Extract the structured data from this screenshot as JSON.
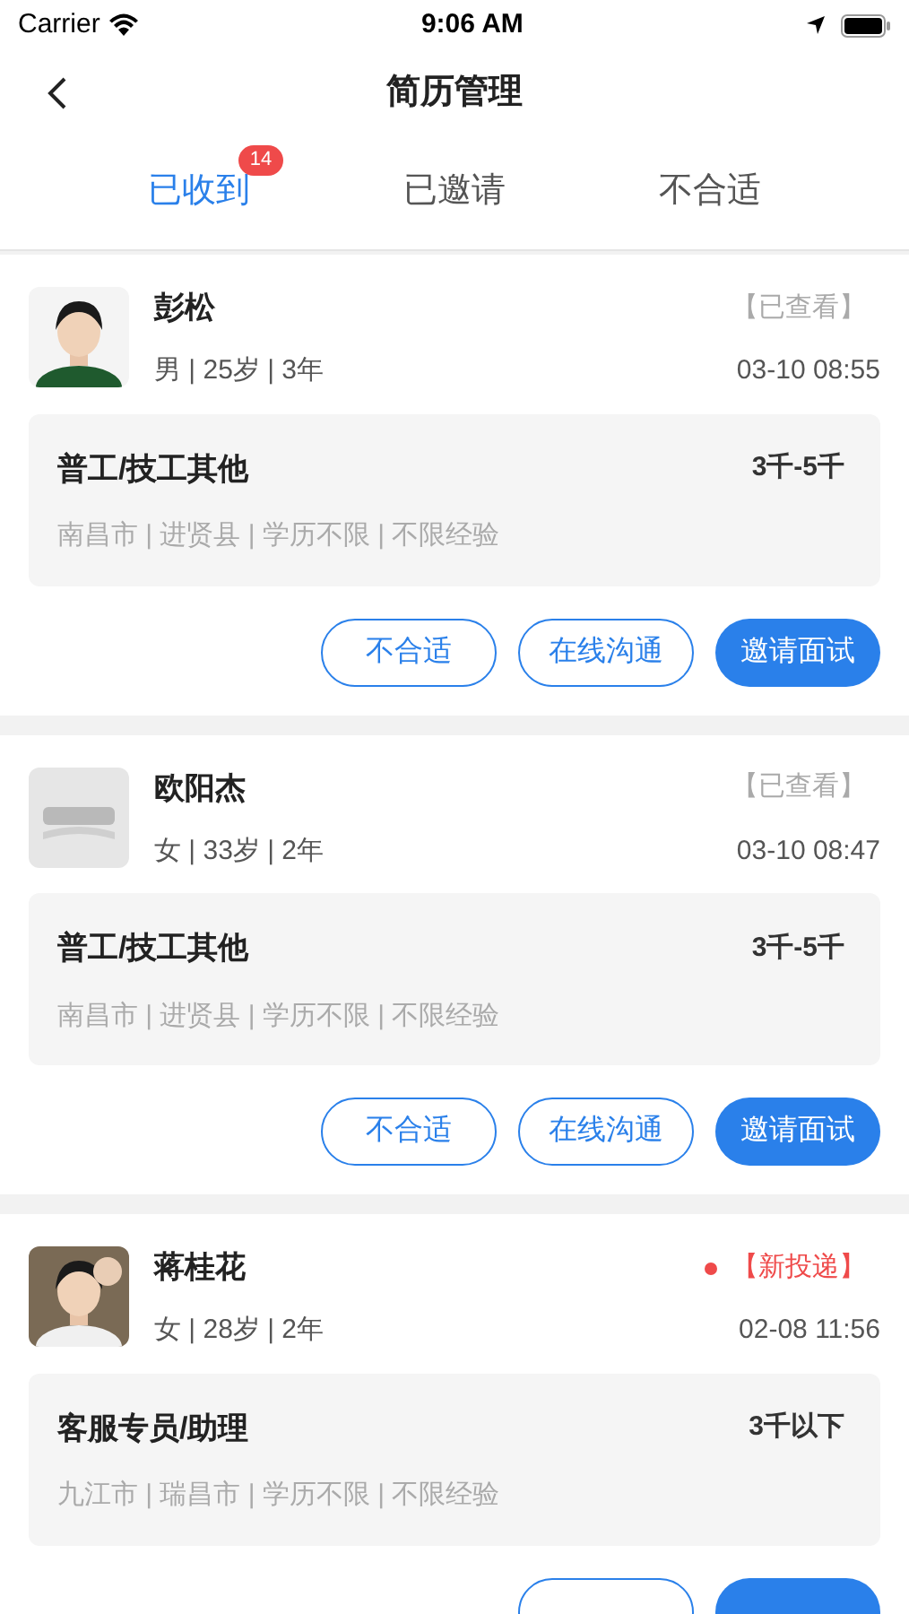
{
  "status_bar": {
    "carrier": "Carrier",
    "time": "9:06 AM"
  },
  "nav": {
    "title": "简历管理"
  },
  "tabs": [
    {
      "label": "已收到",
      "selected": true,
      "badge": "14"
    },
    {
      "label": "已邀请",
      "selected": false
    },
    {
      "label": "不合适",
      "selected": false
    }
  ],
  "resumes": [
    {
      "name": "彭松",
      "status": {
        "kind": "viewed",
        "label": "【已查看】"
      },
      "meta": "男 | 25岁 | 3年",
      "time": "03-10 08:55",
      "job": "普工/技工其他",
      "salary": "3千-5千",
      "details": "南昌市 | 进贤县 | 学历不限 | 不限经验",
      "buttons": [
        {
          "label": "不合适",
          "kind": "outline"
        },
        {
          "label": "在线沟通",
          "kind": "outline"
        },
        {
          "label": "邀请面试",
          "kind": "filled"
        }
      ]
    },
    {
      "name": "欧阳杰",
      "status": {
        "kind": "viewed",
        "label": "【已查看】"
      },
      "meta": "女 | 33岁 | 2年",
      "time": "03-10 08:47",
      "job": "普工/技工其他",
      "salary": "3千-5千",
      "details": "南昌市 | 进贤县 | 学历不限 | 不限经验",
      "buttons": [
        {
          "label": "不合适",
          "kind": "outline"
        },
        {
          "label": "在线沟通",
          "kind": "outline"
        },
        {
          "label": "邀请面试",
          "kind": "filled"
        }
      ]
    },
    {
      "name": "蒋桂花",
      "status": {
        "kind": "new",
        "label": "【新投递】"
      },
      "meta": "女 | 28岁 | 2年",
      "time": "02-08 11:56",
      "job": "客服专员/助理",
      "salary": "3千以下",
      "details": "九江市 | 瑞昌市 | 学历不限 | 不限经验",
      "buttons": [
        {
          "kind": "outline"
        },
        {
          "kind": "filled"
        }
      ]
    }
  ]
}
